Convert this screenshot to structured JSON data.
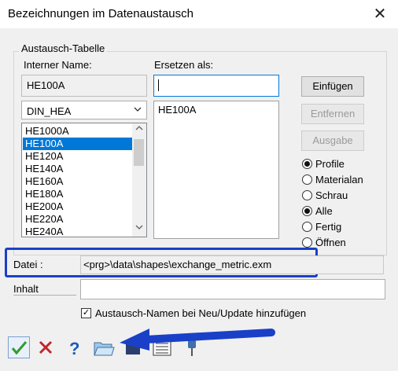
{
  "window": {
    "title": "Bezeichnungen im Datenaustausch",
    "close_glyph": "✕"
  },
  "group": {
    "legend": "Austausch-Tabelle"
  },
  "internal": {
    "label": "Interner Name:",
    "value": "HE100A"
  },
  "replace": {
    "label": "Ersetzen als:",
    "value": "",
    "list": [
      "HE100A"
    ]
  },
  "profile_combo": {
    "selected": "DIN_HEA"
  },
  "names_list": {
    "items": [
      "HE1000A",
      "HE100A",
      "HE120A",
      "HE140A",
      "HE160A",
      "HE180A",
      "HE200A",
      "HE220A",
      "HE240A"
    ],
    "selected_index": 1
  },
  "buttons": {
    "insert": "Einfügen",
    "remove": "Entfernen",
    "output": "Ausgabe"
  },
  "radios": [
    {
      "label": "Profile",
      "checked": true
    },
    {
      "label": "Materialan",
      "checked": false
    },
    {
      "label": "Schrau",
      "checked": false
    },
    {
      "label": "Alle",
      "checked": true
    },
    {
      "label": "Fertig",
      "checked": false
    },
    {
      "label": "Öffnen",
      "checked": false
    }
  ],
  "file": {
    "label": "Datei :",
    "value": "<prg>\\data\\shapes\\exchange_metric.exm"
  },
  "content": {
    "label": "Inhalt",
    "value": ""
  },
  "checkbox": {
    "label": "Austausch-Namen bei Neu/Update hinzufügen",
    "checked": true
  },
  "toolbar": {
    "icons": [
      "ok-checkmark-icon",
      "cancel-x-icon",
      "help-question-icon",
      "open-folder-icon",
      "save-disk-icon",
      "list-view-icon",
      "pin-icon"
    ]
  },
  "colors": {
    "highlight": "#1a40c8",
    "selection": "#0078d7"
  }
}
